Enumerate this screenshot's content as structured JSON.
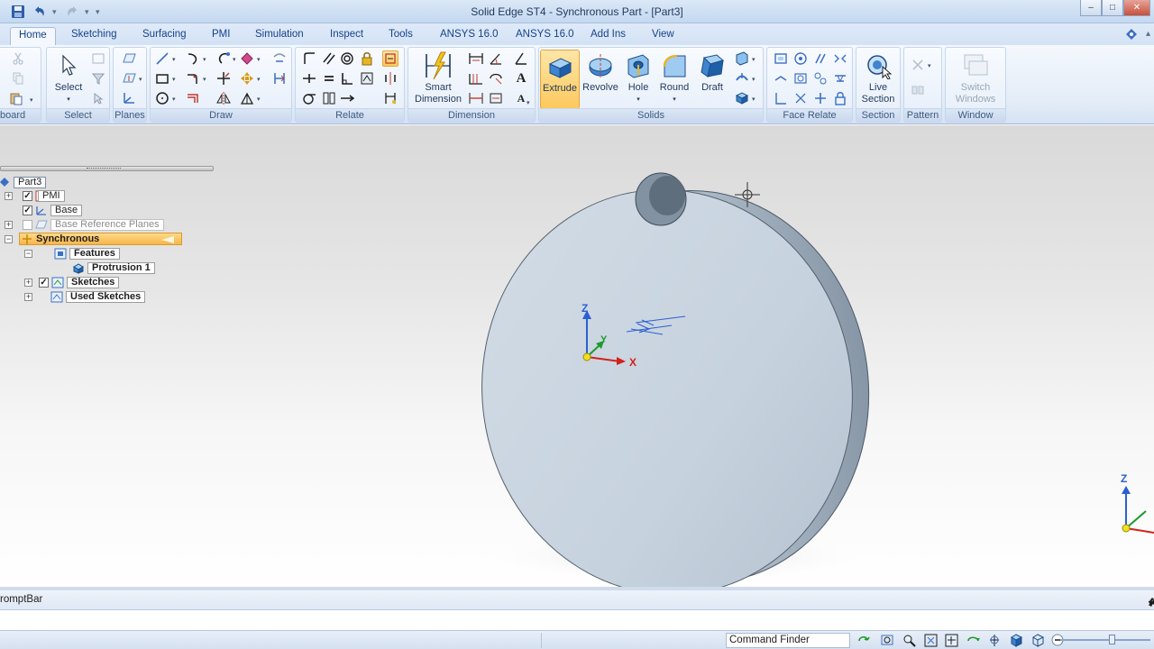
{
  "window": {
    "title": "Solid Edge ST4 - Synchronous Part - [Part3]",
    "minimize": "–",
    "maximize": "□",
    "close": "✕"
  },
  "tabs": [
    "Home",
    "Sketching",
    "Surfacing",
    "PMI",
    "Simulation",
    "Inspect",
    "Tools",
    "ANSYS 16.0",
    "ANSYS 16.0",
    "Add Ins",
    "View"
  ],
  "ribbon": {
    "groups": {
      "clipboard": "board",
      "select": "Select",
      "planes": "Planes",
      "draw": "Draw",
      "relate": "Relate",
      "dimension": "Dimension",
      "solids": "Solids",
      "face_relate": "Face Relate",
      "section": "Section",
      "pattern": "Pattern",
      "window": "Window"
    },
    "buttons": {
      "select": "Select",
      "smart_dimension_1": "Smart",
      "smart_dimension_2": "Dimension",
      "extrude": "Extrude",
      "revolve": "Revolve",
      "hole": "Hole",
      "round": "Round",
      "draft": "Draft",
      "live_section_1": "Live",
      "live_section_2": "Section",
      "switch_windows_1": "Switch",
      "switch_windows_2": "Windows"
    }
  },
  "tree": {
    "root": "Part3",
    "pmi": "PMI",
    "base": "Base",
    "base_ref": "Base Reference Planes",
    "synchronous": "Synchronous",
    "features": "Features",
    "protrusion": "Protrusion 1",
    "sketches": "Sketches",
    "used_sketches": "Used Sketches"
  },
  "viewport": {
    "axis_z": "Z",
    "axis_y": "Y",
    "axis_x": "X",
    "mini_z": "Z"
  },
  "promptbar": {
    "title": "romptBar"
  },
  "statusbar": {
    "command_finder": "Command Finder"
  },
  "colors": {
    "accent": "#15428b",
    "active_button": "#fcc95d",
    "part_face": "#c9d6e1",
    "part_side": "#a9b8c6"
  }
}
